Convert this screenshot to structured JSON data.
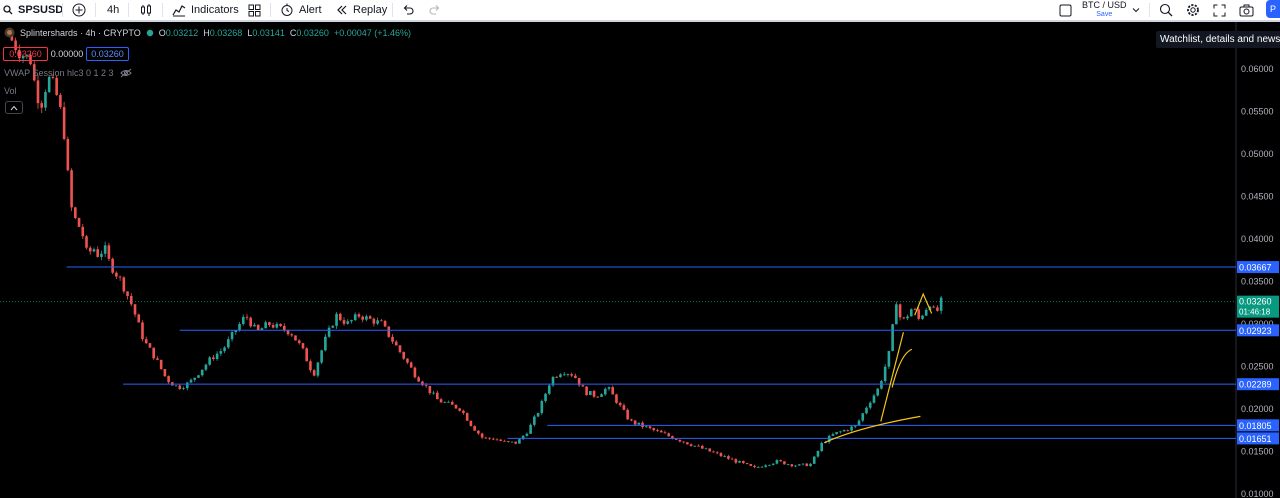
{
  "toolbar": {
    "symbol": "SPSUSD",
    "interval": "4h",
    "indicators": "Indicators",
    "alert": "Alert",
    "replay": "Replay",
    "compare_symbol": "BTC / USD",
    "compare_save": "Save",
    "publish": "P"
  },
  "legend": {
    "name": "Splintershards · 4h · CRYPTO",
    "open": "0.03212",
    "high": "0.03268",
    "low": "0.03141",
    "close": "0.03260",
    "change": "+0.00047 (+1.46%)",
    "bid": "0.03260",
    "spread": "0.00000",
    "ask": "0.03260",
    "vwap": "VWAP Session hlc3 0 1 2 3",
    "vol": "Vol"
  },
  "tooltip": "Watchlist, details and news",
  "colors": {
    "background": "#000000",
    "up": "#26a69a",
    "down": "#ef5350",
    "hline": "#2962ff",
    "annotation": "#f5c518",
    "current_price": "#089981"
  },
  "chart_data": {
    "type": "candlestick",
    "symbol": "SPSUSD",
    "interval": "4h",
    "y_axis_ticks": [
      "0.06000",
      "0.05500",
      "0.05000",
      "0.04500",
      "0.04000",
      "0.03500",
      "0.03000",
      "0.02500",
      "0.02000",
      "0.01500",
      "0.01000"
    ],
    "ylim": [
      0.0095,
      0.0655
    ],
    "close_path": [
      [
        0,
        0.064
      ],
      [
        2,
        0.062
      ],
      [
        4,
        0.061
      ],
      [
        5,
        0.057
      ],
      [
        6,
        0.056
      ],
      [
        7,
        0.059
      ],
      [
        8,
        0.058
      ],
      [
        9,
        0.056
      ],
      [
        10,
        0.052
      ],
      [
        11,
        0.044
      ],
      [
        12,
        0.042
      ],
      [
        13,
        0.041
      ],
      [
        14,
        0.038
      ],
      [
        15,
        0.039
      ],
      [
        16,
        0.038
      ],
      [
        17,
        0.039
      ],
      [
        18,
        0.037
      ],
      [
        20,
        0.035
      ],
      [
        22,
        0.032
      ],
      [
        24,
        0.028
      ],
      [
        26,
        0.026
      ],
      [
        28,
        0.0235
      ],
      [
        30,
        0.0225
      ],
      [
        32,
        0.023
      ],
      [
        34,
        0.0245
      ],
      [
        36,
        0.026
      ],
      [
        38,
        0.027
      ],
      [
        40,
        0.029
      ],
      [
        42,
        0.031
      ],
      [
        44,
        0.029
      ],
      [
        46,
        0.03
      ],
      [
        48,
        0.0295
      ],
      [
        50,
        0.029
      ],
      [
        52,
        0.027
      ],
      [
        54,
        0.024
      ],
      [
        56,
        0.028
      ],
      [
        58,
        0.031
      ],
      [
        60,
        0.03
      ],
      [
        62,
        0.031
      ],
      [
        64,
        0.0305
      ],
      [
        66,
        0.03
      ],
      [
        68,
        0.028
      ],
      [
        70,
        0.026
      ],
      [
        72,
        0.024
      ],
      [
        74,
        0.0225
      ],
      [
        76,
        0.021
      ],
      [
        78,
        0.0205
      ],
      [
        80,
        0.02
      ],
      [
        82,
        0.018
      ],
      [
        84,
        0.0165
      ],
      [
        86,
        0.0165
      ],
      [
        88,
        0.016
      ],
      [
        90,
        0.016
      ],
      [
        92,
        0.0175
      ],
      [
        94,
        0.02
      ],
      [
        96,
        0.0235
      ],
      [
        98,
        0.0245
      ],
      [
        100,
        0.024
      ],
      [
        102,
        0.022
      ],
      [
        104,
        0.0215
      ],
      [
        106,
        0.0225
      ],
      [
        108,
        0.0205
      ],
      [
        110,
        0.0185
      ],
      [
        112,
        0.018
      ],
      [
        114,
        0.0175
      ],
      [
        116,
        0.017
      ],
      [
        118,
        0.0165
      ],
      [
        120,
        0.016
      ],
      [
        122,
        0.0155
      ],
      [
        124,
        0.015
      ],
      [
        126,
        0.0145
      ],
      [
        128,
        0.014
      ],
      [
        130,
        0.0135
      ],
      [
        132,
        0.013
      ],
      [
        134,
        0.0135
      ],
      [
        136,
        0.0138
      ],
      [
        138,
        0.0135
      ],
      [
        140,
        0.0133
      ],
      [
        142,
        0.0135
      ],
      [
        144,
        0.016
      ],
      [
        146,
        0.017
      ],
      [
        148,
        0.0175
      ],
      [
        150,
        0.018
      ],
      [
        152,
        0.0205
      ],
      [
        154,
        0.0225
      ],
      [
        156,
        0.027
      ],
      [
        157,
        0.033
      ],
      [
        158,
        0.03
      ],
      [
        159,
        0.031
      ],
      [
        160,
        0.032
      ],
      [
        161,
        0.0305
      ],
      [
        162,
        0.0315
      ],
      [
        163,
        0.0325
      ],
      [
        164,
        0.031
      ],
      [
        165,
        0.0326
      ]
    ],
    "horizontal_lines": [
      {
        "value": 0.03667,
        "label": "0.03667",
        "from": 10
      },
      {
        "value": 0.02923,
        "label": "0.02923",
        "from": 30
      },
      {
        "value": 0.02289,
        "label": "0.02289",
        "from": 20
      },
      {
        "value": 0.01805,
        "label": "0.01805",
        "from": 95
      },
      {
        "value": 0.01651,
        "label": "0.01651",
        "from": 88
      }
    ],
    "current_price": {
      "value": 0.0326,
      "label": "0.03260",
      "countdown": "01:46:18"
    }
  }
}
